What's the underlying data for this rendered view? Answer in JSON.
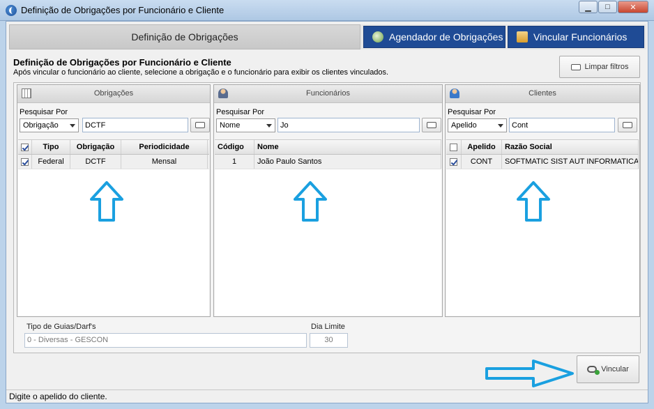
{
  "window": {
    "title": "Definição de Obrigações por Funcionário e Cliente",
    "controls": {
      "minimize": "▁",
      "maximize": "□",
      "close": "✕"
    }
  },
  "tabs": {
    "main": "Definição de Obrigações",
    "agendador": "Agendador de Obrigações",
    "vincular": "Vincular Funcionários"
  },
  "header": {
    "title": "Definição de Obrigações por Funcionário e Cliente",
    "subtitle": "Após vincular o funcionário ao cliente, selecione a obrigação e o funcionário para exibir os clientes vinculados.",
    "clear_filters": "Limpar filtros"
  },
  "panels": {
    "obrigacoes": {
      "title": "Obrigações",
      "search_label": "Pesquisar Por",
      "search_by": "Obrigação",
      "search_value": "DCTF",
      "columns": [
        "Tipo",
        "Obrigação",
        "Periodicidade"
      ],
      "rows": [
        {
          "checked": true,
          "tipo": "Federal",
          "obrigacao": "DCTF",
          "periodicidade": "Mensal"
        }
      ]
    },
    "funcionarios": {
      "title": "Funcionários",
      "search_label": "Pesquisar Por",
      "search_by": "Nome",
      "search_value": "Jo",
      "columns": [
        "Código",
        "Nome"
      ],
      "rows": [
        {
          "codigo": "1",
          "nome": "João Paulo Santos"
        }
      ]
    },
    "clientes": {
      "title": "Clientes",
      "search_label": "Pesquisar Por",
      "search_by": "Apelido",
      "search_value": "Cont",
      "columns": [
        "Apelido",
        "Razão Social"
      ],
      "rows": [
        {
          "checked": true,
          "apelido": "CONT",
          "razao_social": "SOFTMATIC SIST AUT INFORMATICA"
        }
      ]
    }
  },
  "bottom": {
    "tipo_guias_label": "Tipo de Guias/Darf's",
    "tipo_guias_value": "0 - Diversas - GESCON",
    "dia_limite_label": "Dia Limite",
    "dia_limite_value": "30"
  },
  "actions": {
    "vincular": "Vincular"
  },
  "status": "Digite o apelido do cliente.",
  "colors": {
    "accent_blue": "#1f4b95",
    "arrow_blue": "#1aa0e0"
  }
}
